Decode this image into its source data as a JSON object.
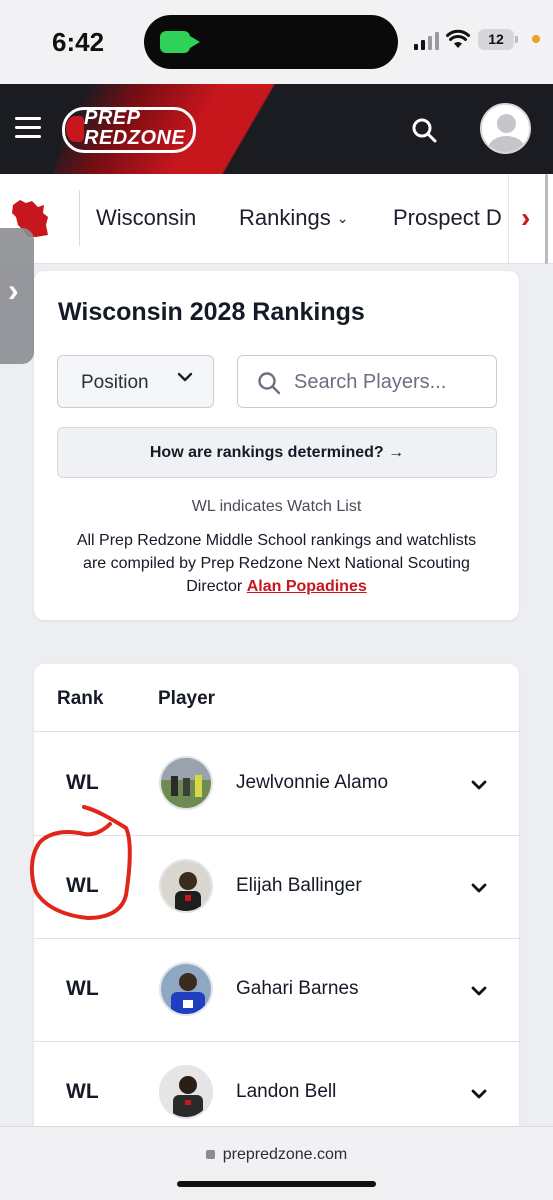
{
  "status_bar": {
    "time": "6:42",
    "battery": "12"
  },
  "header": {
    "logo_line1": "PREP",
    "logo_line2": "REDZONE",
    "brand_color": "#c8161d"
  },
  "subnav": {
    "items": [
      {
        "label": "Wisconsin"
      },
      {
        "label": "Rankings"
      },
      {
        "label": "Prospect D"
      }
    ]
  },
  "rankings_card": {
    "title": "Wisconsin 2028 Rankings",
    "position_select": "Position",
    "search_placeholder": "Search Players...",
    "how_button": "How are rankings determined? →",
    "wl_note": "WL indicates Watch List",
    "description": "All Prep Redzone Middle School rankings and watchlists are compiled by Prep Redzone Next National Scouting Director",
    "director_link": "Alan Popadines"
  },
  "table": {
    "headers": [
      "Rank",
      "Player"
    ],
    "rows": [
      {
        "rank": "WL",
        "name": "Jewlvonnie Alamo"
      },
      {
        "rank": "WL",
        "name": "Elijah Ballinger"
      },
      {
        "rank": "WL",
        "name": "Gahari Barnes"
      },
      {
        "rank": "WL",
        "name": "Landon Bell"
      }
    ]
  },
  "url_bar": {
    "url": "prepredzone.com"
  }
}
